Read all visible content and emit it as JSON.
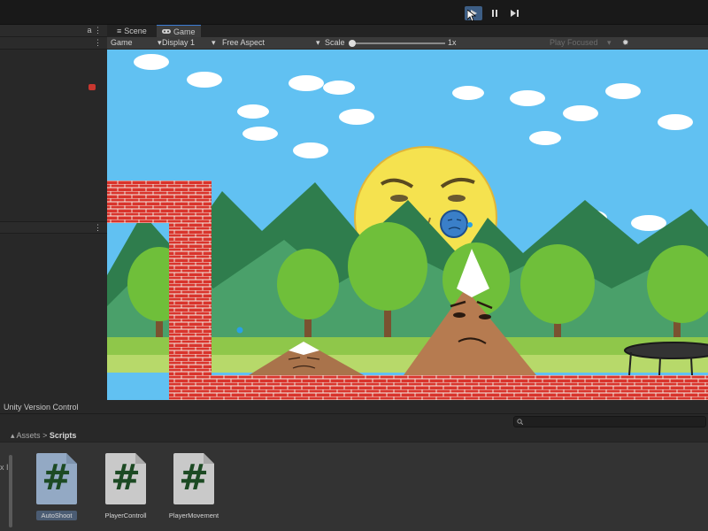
{
  "toolbar": {
    "play_icon": "play-icon",
    "pause_icon": "pause-icon",
    "step_icon": "step-icon"
  },
  "left_panel": {
    "header_icons": "a ⋮",
    "section_menu": "⋮"
  },
  "tabs": [
    {
      "label": "Scene",
      "icon": "hamburger-icon"
    },
    {
      "label": "Game",
      "icon": "gamepad-icon"
    }
  ],
  "game_toolbar": {
    "view_label": "Game",
    "display": "Display 1",
    "aspect": "Free Aspect",
    "scale_label": "Scale",
    "scale_value": "1x",
    "play_mode": "Play Focused"
  },
  "bottom": {
    "version_control": "Unity Version Control",
    "breadcrumb_root": "Assets",
    "breadcrumb_current": "Scripts",
    "side_label": "x I"
  },
  "assets": [
    {
      "name": "AutoShoot",
      "icon": "csharp-script-icon",
      "selected": true
    },
    {
      "name": "PlayerControll",
      "icon": "csharp-script-icon",
      "selected": false
    },
    {
      "name": "PlayerMovement",
      "icon": "csharp-script-icon",
      "selected": false
    }
  ],
  "colors": {
    "sky": "#61c1f2",
    "brick": "#d9342c",
    "sun": "#f5e24f",
    "ground": "#8fc74a",
    "mountain_dark": "#2f7d4d",
    "selection": "#3d5e85"
  }
}
